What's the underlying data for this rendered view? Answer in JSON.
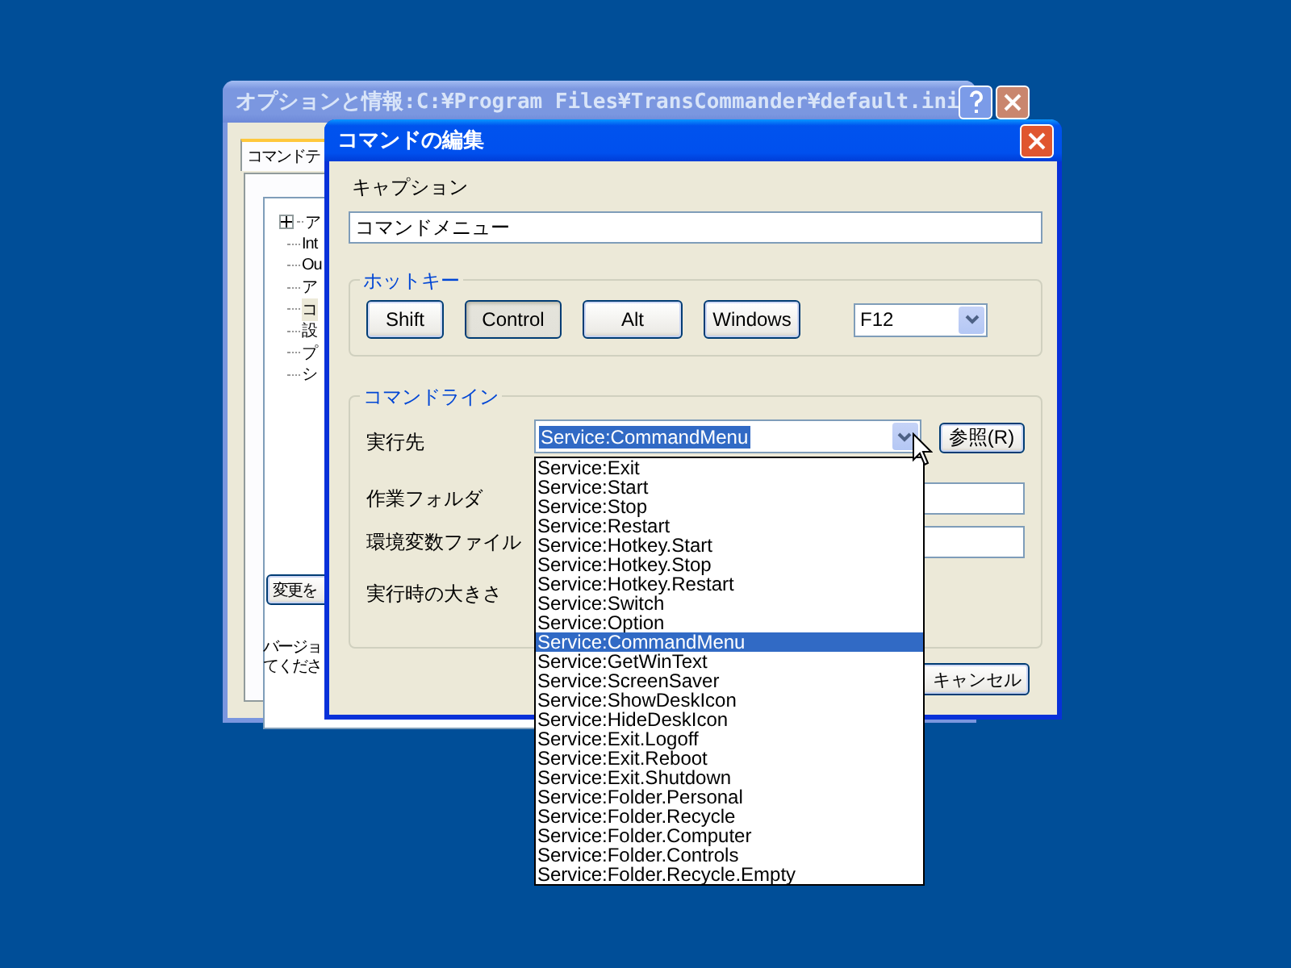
{
  "background_window": {
    "title": "オプションと情報:C:¥Program Files¥TransCommander¥default.ini",
    "tab": {
      "label": "コマンドテ",
      "selected": true
    },
    "tree": [
      {
        "label": "ア",
        "expandable": true,
        "selected": false
      },
      {
        "label": "Int",
        "expandable": false,
        "selected": false
      },
      {
        "label": "Ou",
        "expandable": false,
        "selected": false
      },
      {
        "label": "ア",
        "expandable": false,
        "selected": false
      },
      {
        "label": "コ",
        "expandable": false,
        "selected": true
      },
      {
        "label": "設",
        "expandable": false,
        "selected": false
      },
      {
        "label": "プ",
        "expandable": false,
        "selected": false
      },
      {
        "label": "シ",
        "expandable": false,
        "selected": false
      }
    ],
    "apply_button": "変更を",
    "note_lines": [
      "バージョ",
      "てくださ"
    ]
  },
  "dialog": {
    "title": "コマンドの編集",
    "caption": {
      "label": "キャプション",
      "value": "コマンドメニュー"
    },
    "hotkey": {
      "legend": "ホットキー",
      "keys": [
        {
          "label": "Shift",
          "pressed": false
        },
        {
          "label": "Control",
          "pressed": true
        },
        {
          "label": "Alt",
          "pressed": false
        },
        {
          "label": "Windows",
          "pressed": false
        }
      ],
      "key_value": "F12"
    },
    "command_line": {
      "legend": "コマンドライン",
      "target": {
        "label": "実行先",
        "value": "Service:CommandMenu",
        "browse_button": "参照(R)"
      },
      "work_folder_label": "作業フォルダ",
      "env_file_label": "環境変数ファイル",
      "run_size_label": "実行時の大きさ"
    },
    "cancel_button": "キャンセル",
    "dropdown": [
      {
        "label": "Service:Exit",
        "selected": false
      },
      {
        "label": "Service:Start",
        "selected": false
      },
      {
        "label": "Service:Stop",
        "selected": false
      },
      {
        "label": "Service:Restart",
        "selected": false
      },
      {
        "label": "Service:Hotkey.Start",
        "selected": false
      },
      {
        "label": "Service:Hotkey.Stop",
        "selected": false
      },
      {
        "label": "Service:Hotkey.Restart",
        "selected": false
      },
      {
        "label": "Service:Switch",
        "selected": false
      },
      {
        "label": "Service:Option",
        "selected": false
      },
      {
        "label": "Service:CommandMenu",
        "selected": true
      },
      {
        "label": "Service:GetWinText",
        "selected": false
      },
      {
        "label": "Service:ScreenSaver",
        "selected": false
      },
      {
        "label": "Service:ShowDeskIcon",
        "selected": false
      },
      {
        "label": "Service:HideDeskIcon",
        "selected": false
      },
      {
        "label": "Service:Exit.Logoff",
        "selected": false
      },
      {
        "label": "Service:Exit.Reboot",
        "selected": false
      },
      {
        "label": "Service:Exit.Shutdown",
        "selected": false
      },
      {
        "label": "Service:Folder.Personal",
        "selected": false
      },
      {
        "label": "Service:Folder.Recycle",
        "selected": false
      },
      {
        "label": "Service:Folder.Computer",
        "selected": false
      },
      {
        "label": "Service:Folder.Controls",
        "selected": false
      },
      {
        "label": "Service:Folder.Recycle.Empty",
        "selected": false
      }
    ]
  }
}
